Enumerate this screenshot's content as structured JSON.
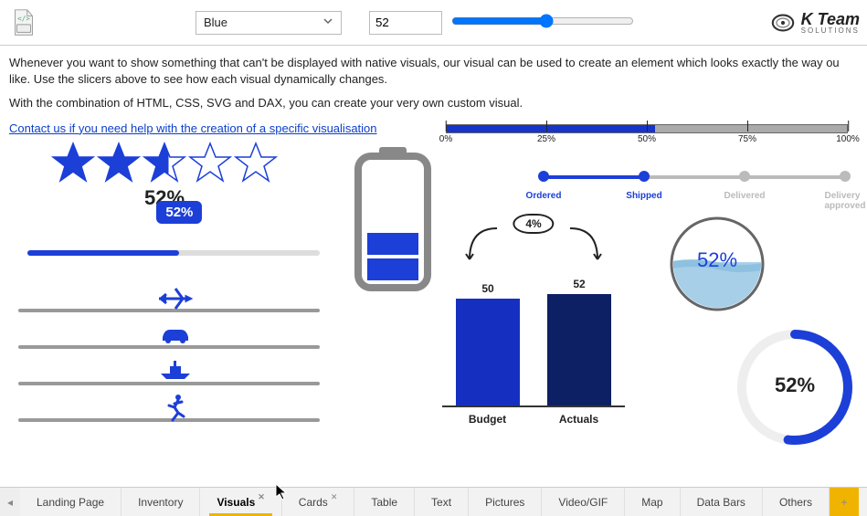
{
  "topbar": {
    "color_select_value": "Blue",
    "value_input": "52",
    "slider_value": 52
  },
  "logo": {
    "brand": "K Team",
    "subtitle": "SOLUTIONS"
  },
  "intro": {
    "p1": "Whenever you want to show something that can't be displayed with native visuals, our visual can be used to create an element which looks exactly the way ou like. Use the slicers above to see how each visual dynamically changes.",
    "p2": "With the combination of HTML, CSS, SVG and DAX, you can create your very own custom visual.",
    "link": "Contact us if you need help with the creation of a specific visualisation"
  },
  "accent_color": "#1c3fd8",
  "stars": {
    "percent_label": "52%",
    "fill_fraction": 0.52,
    "count": 5
  },
  "bubble": {
    "label": "52%",
    "percent": 52
  },
  "steps": {
    "items": [
      "Ordered",
      "Shipped",
      "Delivered",
      "Delivery approved"
    ],
    "active_count": 2
  },
  "scale": {
    "fill_percent": 52,
    "ticks": [
      {
        "pos": 0,
        "label": "0%"
      },
      {
        "pos": 25,
        "label": "25%"
      },
      {
        "pos": 50,
        "label": "50%"
      },
      {
        "pos": 75,
        "label": "75%"
      },
      {
        "pos": 100,
        "label": "100%"
      }
    ]
  },
  "colchart": {
    "diff_label": "4%",
    "labels": {
      "budget": "Budget",
      "actuals": "Actuals"
    },
    "values": {
      "budget": "50",
      "actuals": "52"
    }
  },
  "liquid": {
    "label": "52%",
    "fill": 52
  },
  "donut": {
    "label": "52%",
    "percent": 52
  },
  "battery": {
    "fill": 52
  },
  "tabs": {
    "items": [
      {
        "label": "Landing Page",
        "active": false,
        "closable": false
      },
      {
        "label": "Inventory",
        "active": false,
        "closable": false
      },
      {
        "label": "Visuals",
        "active": true,
        "closable": true
      },
      {
        "label": "Cards",
        "active": false,
        "closable": true
      },
      {
        "label": "Table",
        "active": false,
        "closable": false
      },
      {
        "label": "Text",
        "active": false,
        "closable": false
      },
      {
        "label": "Pictures",
        "active": false,
        "closable": false
      },
      {
        "label": "Video/GIF",
        "active": false,
        "closable": false
      },
      {
        "label": "Map",
        "active": false,
        "closable": false
      },
      {
        "label": "Data Bars",
        "active": false,
        "closable": false
      },
      {
        "label": "Others",
        "active": false,
        "closable": false
      }
    ]
  },
  "chart_data": {
    "type": "bar",
    "categories": [
      "Budget",
      "Actuals"
    ],
    "values": [
      50,
      52
    ],
    "diff_percent": 4,
    "title": "",
    "xlabel": "",
    "ylabel": "",
    "ylim": [
      0,
      60
    ]
  }
}
